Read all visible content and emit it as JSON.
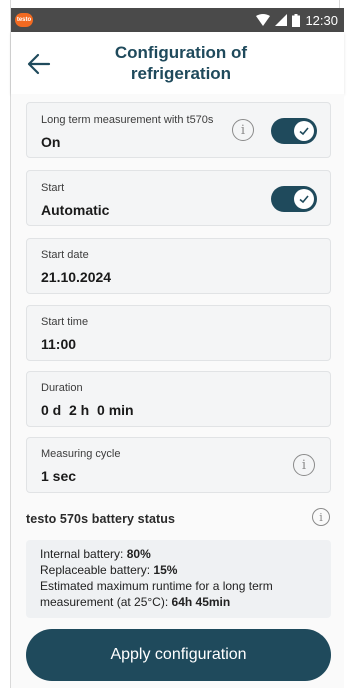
{
  "statusbar": {
    "logo": "testo",
    "time": "12:30"
  },
  "header": {
    "title_line1": "Configuration of",
    "title_line2": "refrigeration"
  },
  "fields": {
    "long_term": {
      "label": "Long term measurement with t570s",
      "value": "On",
      "toggle_on": true
    },
    "start": {
      "label": "Start",
      "value": "Automatic",
      "toggle_on": true
    },
    "start_date": {
      "label": "Start date",
      "value": "21.10.2024"
    },
    "start_time": {
      "label": "Start time",
      "value": "11:00"
    },
    "duration": {
      "label": "Duration",
      "value": "0 d  2 h  0 min"
    },
    "measuring_cycle": {
      "label": "Measuring cycle",
      "value": "1 sec"
    }
  },
  "battery": {
    "title": "testo 570s battery status",
    "internal_label": "Internal battery: ",
    "internal_value": "80%",
    "replaceable_label": "Replaceable battery: ",
    "replaceable_value": "15%",
    "runtime_label_line1": "Estimated maximum runtime for a long term",
    "runtime_label_line2": "measurement (at 25°C): ",
    "runtime_value": "64h 45min"
  },
  "apply_button": "Apply configuration",
  "colors": {
    "primary": "#1f4a5c",
    "statusbar": "#4a4a4a",
    "logo": "#f26a21",
    "card": "#f4f5f6"
  }
}
